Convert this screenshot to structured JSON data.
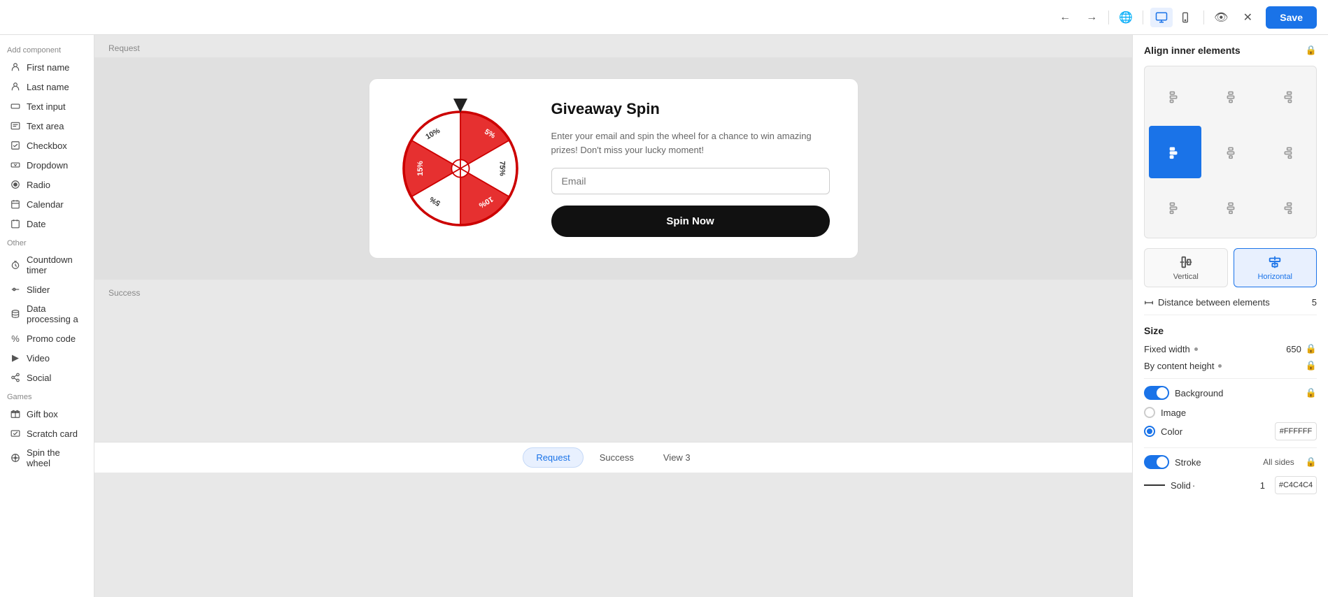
{
  "toolbar": {
    "save_label": "Save"
  },
  "left_sidebar": {
    "title": "Add component",
    "form_items": [
      {
        "id": "first-name",
        "label": "First name",
        "icon": "person"
      },
      {
        "id": "last-name",
        "label": "Last name",
        "icon": "person"
      },
      {
        "id": "text-input",
        "label": "Text input",
        "icon": "input"
      },
      {
        "id": "text-area",
        "label": "Text area",
        "icon": "textarea"
      },
      {
        "id": "checkbox",
        "label": "Checkbox",
        "icon": "check"
      },
      {
        "id": "dropdown",
        "label": "Dropdown",
        "icon": "dropdown"
      },
      {
        "id": "radio",
        "label": "Radio",
        "icon": "radio"
      },
      {
        "id": "calendar",
        "label": "Calendar",
        "icon": "calendar"
      },
      {
        "id": "date",
        "label": "Date",
        "icon": "date"
      }
    ],
    "other_title": "Other",
    "other_items": [
      {
        "id": "countdown-timer",
        "label": "Countdown timer",
        "icon": "timer"
      },
      {
        "id": "slider",
        "label": "Slider",
        "icon": "slider"
      },
      {
        "id": "data-processing",
        "label": "Data processing a",
        "icon": "data"
      },
      {
        "id": "promo-code",
        "label": "Promo code",
        "icon": "promo"
      },
      {
        "id": "video",
        "label": "Video",
        "icon": "video"
      },
      {
        "id": "social",
        "label": "Social",
        "icon": "social"
      }
    ],
    "games_title": "Games",
    "games_items": [
      {
        "id": "gift-box",
        "label": "Gift box",
        "icon": "gift"
      },
      {
        "id": "scratch-card",
        "label": "Scratch card",
        "icon": "scratch"
      },
      {
        "id": "spin-the-wheel",
        "label": "Spin the wheel",
        "icon": "wheel"
      }
    ]
  },
  "canvas": {
    "request_label": "Request",
    "success_label": "Success",
    "widget": {
      "title": "Giveaway Spin",
      "description": "Enter your email and spin the wheel for a chance to win amazing prizes! Don't miss your lucky moment!",
      "email_placeholder": "Email",
      "spin_button_label": "Spin Now",
      "wheel_segments": [
        {
          "value": "5%",
          "color": "#e63030",
          "angle": 0
        },
        {
          "value": "75%",
          "color": "#fff",
          "angle": 60
        },
        {
          "value": "10%",
          "color": "#e63030",
          "angle": 120
        },
        {
          "value": "5",
          "color": "#fff",
          "angle": 180
        },
        {
          "value": "15%",
          "color": "#e63030",
          "angle": 240
        },
        {
          "value": "10%",
          "color": "#fff",
          "angle": 300
        }
      ]
    }
  },
  "bottom_tabs": [
    {
      "id": "request",
      "label": "Request",
      "active": true
    },
    {
      "id": "success",
      "label": "Success",
      "active": false
    },
    {
      "id": "view3",
      "label": "View 3",
      "active": false
    }
  ],
  "right_panel": {
    "title": "Align inner elements",
    "alignment_grid": {
      "cells": [
        "top-left",
        "top-center",
        "top-right",
        "middle-left",
        "middle-center",
        "middle-right",
        "bottom-left",
        "bottom-center",
        "bottom-right"
      ],
      "active": "middle-left"
    },
    "direction": {
      "vertical_label": "Vertical",
      "horizontal_label": "Horizontal",
      "active": "horizontal"
    },
    "distance_label": "Distance between elements",
    "distance_value": "5",
    "size_section": "Size",
    "fixed_width_label": "Fixed width",
    "fixed_width_dot": true,
    "fixed_width_value": "650",
    "by_content_label": "By content height",
    "by_content_dot": true,
    "background_label": "Background",
    "background_enabled": true,
    "background_image_label": "Image",
    "background_color_label": "Color",
    "background_color_selected": true,
    "background_color_value": "#FFFFFF",
    "stroke_label": "Stroke",
    "stroke_enabled": true,
    "stroke_sides": "All sides",
    "stroke_type": "Solid",
    "stroke_type_dot": true,
    "stroke_width": "1",
    "stroke_color": "#C4C4C4"
  }
}
